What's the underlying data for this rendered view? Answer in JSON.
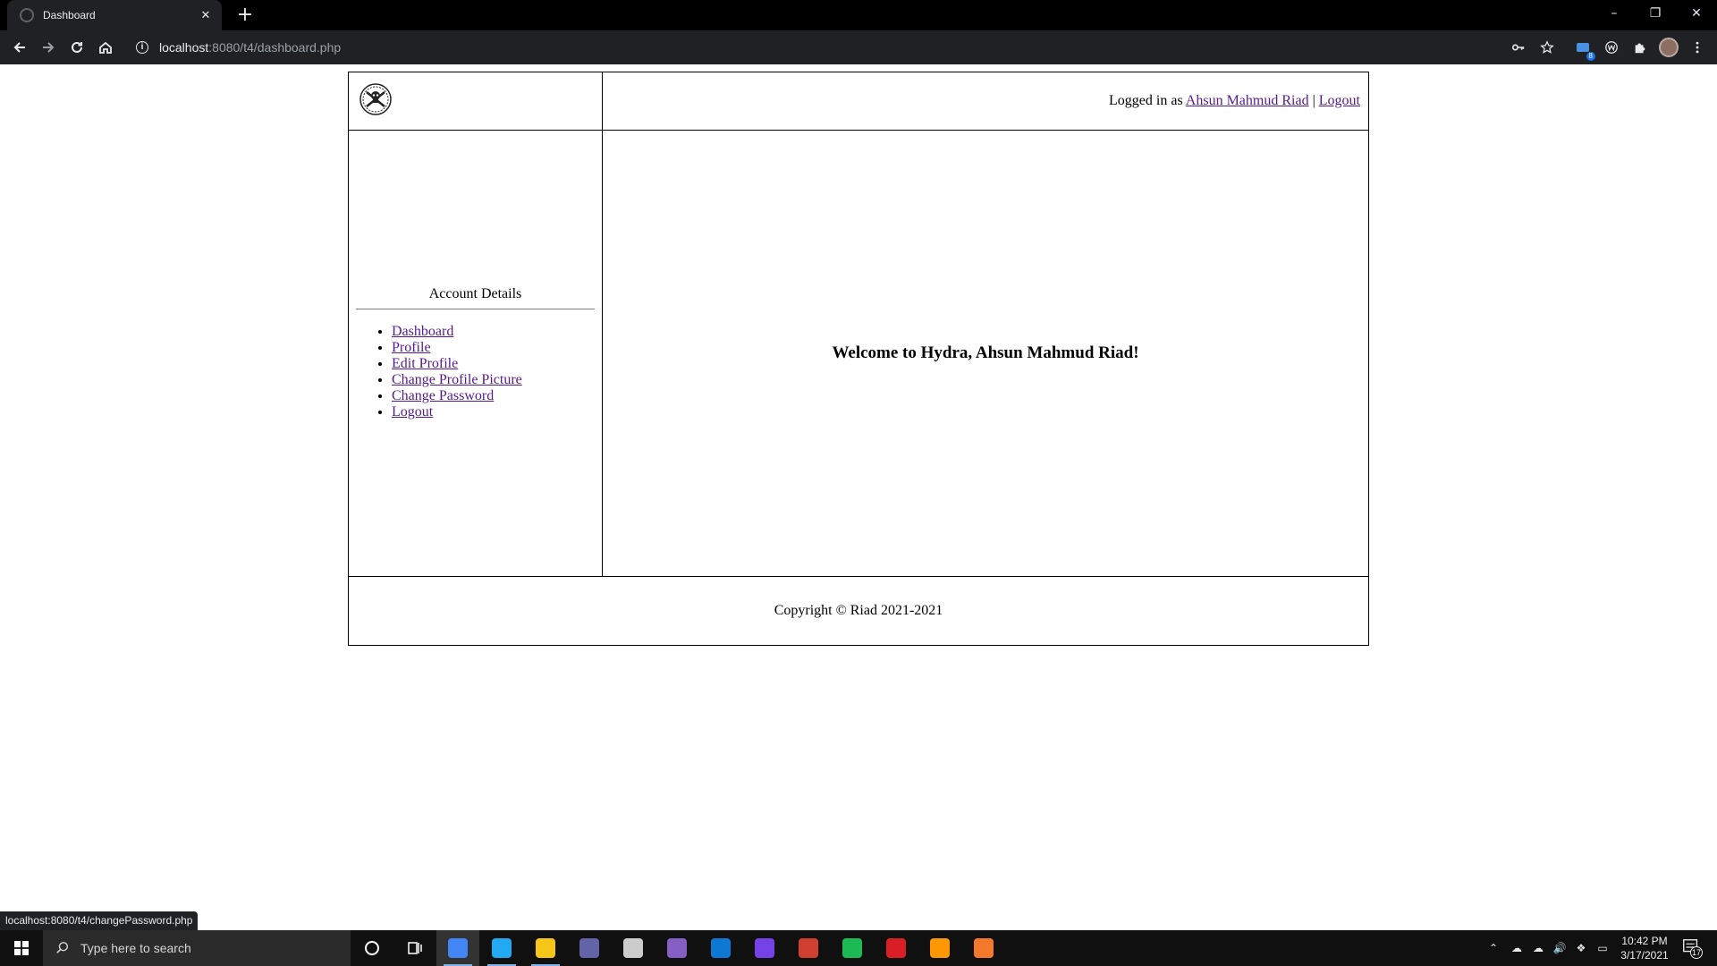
{
  "browser": {
    "tab_title": "Dashboard",
    "tab_close": "✕",
    "new_tab": "+",
    "url_host": "localhost",
    "url_path": ":8080/t4/dashboard.php",
    "extension_badge": "8",
    "status_link": "localhost:8080/t4/changePassword.php",
    "window_controls": {
      "minimize": "–",
      "restore": "❐",
      "close": "✕"
    }
  },
  "page": {
    "header": {
      "logged_in_prefix": "Logged in as ",
      "user_name": "Ahsun Mahmud Riad",
      "separator": " | ",
      "logout": "Logout"
    },
    "sidebar": {
      "title": "Account Details",
      "items": [
        {
          "label": "Dashboard"
        },
        {
          "label": "Profile"
        },
        {
          "label": "Edit Profile"
        },
        {
          "label": "Change Profile Picture"
        },
        {
          "label": "Change Password"
        },
        {
          "label": "Logout"
        }
      ]
    },
    "main": {
      "welcome": "Welcome to Hydra, Ahsun Mahmud Riad!"
    },
    "footer": {
      "copyright": "Copyright © Riad 2021-2021"
    },
    "link_color": "#551a8b"
  },
  "taskbar": {
    "search_placeholder": "Type here to search",
    "apps": [
      {
        "name": "chrome",
        "color": "#4285f4",
        "active": true
      },
      {
        "name": "vscode",
        "color": "#23a9f2",
        "active": false
      },
      {
        "name": "file-explorer",
        "color": "#f5c518",
        "active": false
      },
      {
        "name": "teams",
        "color": "#6264a7",
        "active": false
      },
      {
        "name": "obs",
        "color": "#cccccc",
        "active": false
      },
      {
        "name": "visual-studio",
        "color": "#865fc5",
        "active": false
      },
      {
        "name": "outlook",
        "color": "#0f78d4",
        "active": false
      },
      {
        "name": "firefox",
        "color": "#7542e5",
        "active": false
      },
      {
        "name": "app-globe",
        "color": "#d04030",
        "active": false
      },
      {
        "name": "spotify",
        "color": "#1db954",
        "active": false
      },
      {
        "name": "acrobat",
        "color": "#d91f26",
        "active": false
      },
      {
        "name": "sublime-text",
        "color": "#ff9800",
        "active": false
      },
      {
        "name": "blender",
        "color": "#f5792a",
        "active": false
      }
    ],
    "clock_time": "10:42 PM",
    "clock_date": "3/17/2021",
    "notification_count": "17"
  }
}
